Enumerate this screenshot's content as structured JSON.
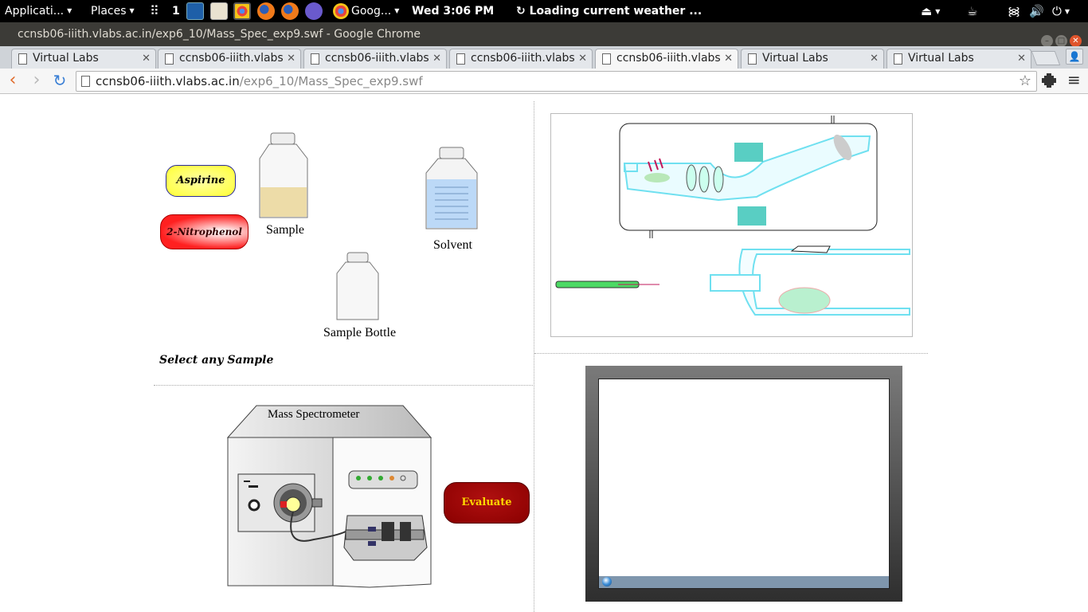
{
  "panel": {
    "applications": "Applicati...",
    "places": "Places",
    "workspace": "1",
    "chrome_task": "Goog...",
    "clock": "Wed  3:06 PM",
    "weather": "Loading current weather ..."
  },
  "window": {
    "title": "ccnsb06-iiith.vlabs.ac.in/exp6_10/Mass_Spec_exp9.swf - Google Chrome"
  },
  "tabs": [
    {
      "label": "Virtual Labs"
    },
    {
      "label": "ccnsb06-iiith.vlabs"
    },
    {
      "label": "ccnsb06-iiith.vlabs"
    },
    {
      "label": "ccnsb06-iiith.vlabs"
    },
    {
      "label": "ccnsb06-iiith.vlabs"
    },
    {
      "label": "Virtual Labs"
    },
    {
      "label": "Virtual Labs"
    }
  ],
  "omnibox": {
    "host": "ccnsb06-iiith.vlabs.ac.in",
    "path": "/exp6_10/Mass_Spec_exp9.swf"
  },
  "sim": {
    "aspirine": "Aspirine",
    "nitrophenol": "2-Nitrophenol",
    "sample": "Sample",
    "solvent": "Solvent",
    "sample_bottle": "Sample Bottle",
    "select_prompt": "Select any Sample",
    "mass_spec": "Mass Spectrometer",
    "evaluate": "Evaluate"
  },
  "colors": {
    "aspirine_fill": "#ffff66",
    "nitrophenol_fill": "#ff1a1a",
    "evaluate_fill": "#990000",
    "evaluate_text": "#ffd700"
  }
}
